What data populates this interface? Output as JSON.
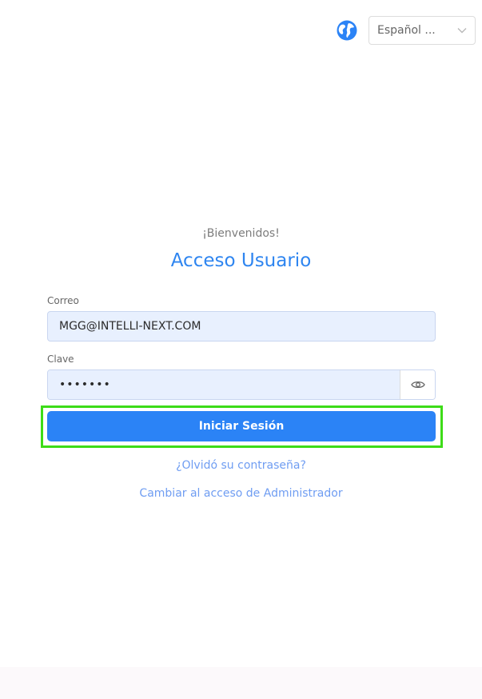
{
  "language": {
    "selected": "Español ...",
    "icon": "globe-icon",
    "chevron_icon": "chevron-down-icon"
  },
  "header": {
    "welcome": "¡Bienvenidos!",
    "title": "Acceso Usuario"
  },
  "form": {
    "email": {
      "label": "Correo",
      "value": "MGG@INTELLI-NEXT.COM"
    },
    "password": {
      "label": "Clave",
      "value": "•••••••",
      "toggle_icon": "eye-icon"
    },
    "submit_label": "Iniciar Sesión"
  },
  "links": {
    "forgot": "¿Olvidó su contraseña?",
    "admin": "Cambiar al acceso de Administrador"
  },
  "colors": {
    "primary": "#2b83f6",
    "title": "#2e85f0",
    "link": "#6f9df2",
    "highlight": "#3ddc18",
    "input_bg": "#e8f0fe"
  }
}
